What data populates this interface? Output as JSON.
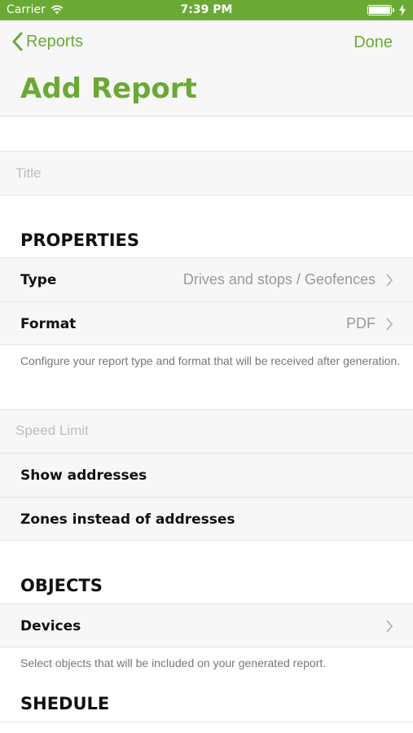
{
  "status_bar": {
    "carrier": "Carrier",
    "time": "7:39 PM",
    "icons": [
      "wifi-icon",
      "battery-icon",
      "charging-bolt-icon"
    ]
  },
  "nav": {
    "back_label": "Reports",
    "done_label": "Done",
    "title": "Add Report"
  },
  "fields": {
    "title_placeholder": "Title"
  },
  "properties": {
    "header": "PROPERTIES",
    "rows": [
      {
        "label": "Type",
        "value": "Drives and stops / Geofences"
      },
      {
        "label": "Format",
        "value": "PDF"
      }
    ],
    "note": "Configure your report type and format that will be received after generation."
  },
  "options": {
    "speed_limit_placeholder": "Speed Limit",
    "show_addresses": "Show addresses",
    "zones_instead": "Zones instead of addresses"
  },
  "objects": {
    "header": "OBJECTS",
    "devices_label": "Devices",
    "note": "Select objects that will be included on your generated report."
  },
  "schedule": {
    "header": "SHEDULE"
  },
  "colors": {
    "accent": "#6aaa34",
    "cell_bg": "#f7f7f7",
    "separator": "#e4e4e4",
    "secondary_text": "#999999"
  }
}
